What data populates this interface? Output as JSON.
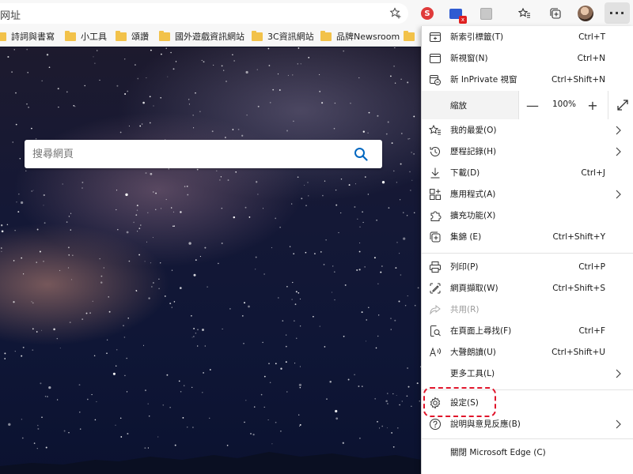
{
  "address_bar": {
    "placeholder": "网址"
  },
  "bookmarks": [
    {
      "label": "詩詞與書寫"
    },
    {
      "label": "小工具"
    },
    {
      "label": "頌讚"
    },
    {
      "label": "國外遊戲資訊網站"
    },
    {
      "label": "3C資訊網站"
    },
    {
      "label": "品牌Newsroom"
    }
  ],
  "toolbar_icons": [
    "s-extension-icon",
    "blue-extension-icon",
    "grey-extension-icon",
    "favorites-icon",
    "collections-icon",
    "profile-avatar",
    "more-icon"
  ],
  "search": {
    "placeholder": "搜尋網頁"
  },
  "menu": {
    "group1": [
      {
        "label": "新索引標籤(T)",
        "shortcut": "Ctrl+T",
        "icon": "new-tab-icon"
      },
      {
        "label": "新視窗(N)",
        "shortcut": "Ctrl+N",
        "icon": "new-window-icon"
      },
      {
        "label": "新 InPrivate 視窗",
        "shortcut": "Ctrl+Shift+N",
        "icon": "inprivate-icon"
      }
    ],
    "zoom": {
      "label": "縮放",
      "value": "100%"
    },
    "group2": [
      {
        "label": "我的最愛(O)",
        "shortcut": "",
        "icon": "favorites-icon",
        "submenu": true
      },
      {
        "label": "歷程記錄(H)",
        "shortcut": "",
        "icon": "history-icon",
        "submenu": true
      },
      {
        "label": "下載(D)",
        "shortcut": "Ctrl+J",
        "icon": "download-icon"
      },
      {
        "label": "應用程式(A)",
        "shortcut": "",
        "icon": "apps-icon",
        "submenu": true
      },
      {
        "label": "擴充功能(X)",
        "shortcut": "",
        "icon": "extensions-icon"
      },
      {
        "label": "集錦 (E)",
        "shortcut": "Ctrl+Shift+Y",
        "icon": "collections-icon"
      }
    ],
    "group3": [
      {
        "label": "列印(P)",
        "shortcut": "Ctrl+P",
        "icon": "print-icon"
      },
      {
        "label": "網頁擷取(W)",
        "shortcut": "Ctrl+Shift+S",
        "icon": "web-capture-icon"
      },
      {
        "label": "共用(R)",
        "shortcut": "",
        "icon": "share-icon",
        "disabled": true
      },
      {
        "label": "在頁面上尋找(F)",
        "shortcut": "Ctrl+F",
        "icon": "find-icon"
      },
      {
        "label": "大聲朗讀(U)",
        "shortcut": "Ctrl+Shift+U",
        "icon": "read-aloud-icon"
      },
      {
        "label": "更多工具(L)",
        "shortcut": "",
        "icon": "",
        "submenu": true
      }
    ],
    "group4": [
      {
        "label": "設定(S)",
        "shortcut": "",
        "icon": "settings-icon"
      },
      {
        "label": "說明與意見反應(B)",
        "shortcut": "",
        "icon": "help-icon",
        "submenu": true
      }
    ],
    "close": {
      "label": "關閉 Microsoft Edge (C)"
    }
  },
  "colors": {
    "accent": "#0067c0",
    "highlight": "#e0152b"
  }
}
